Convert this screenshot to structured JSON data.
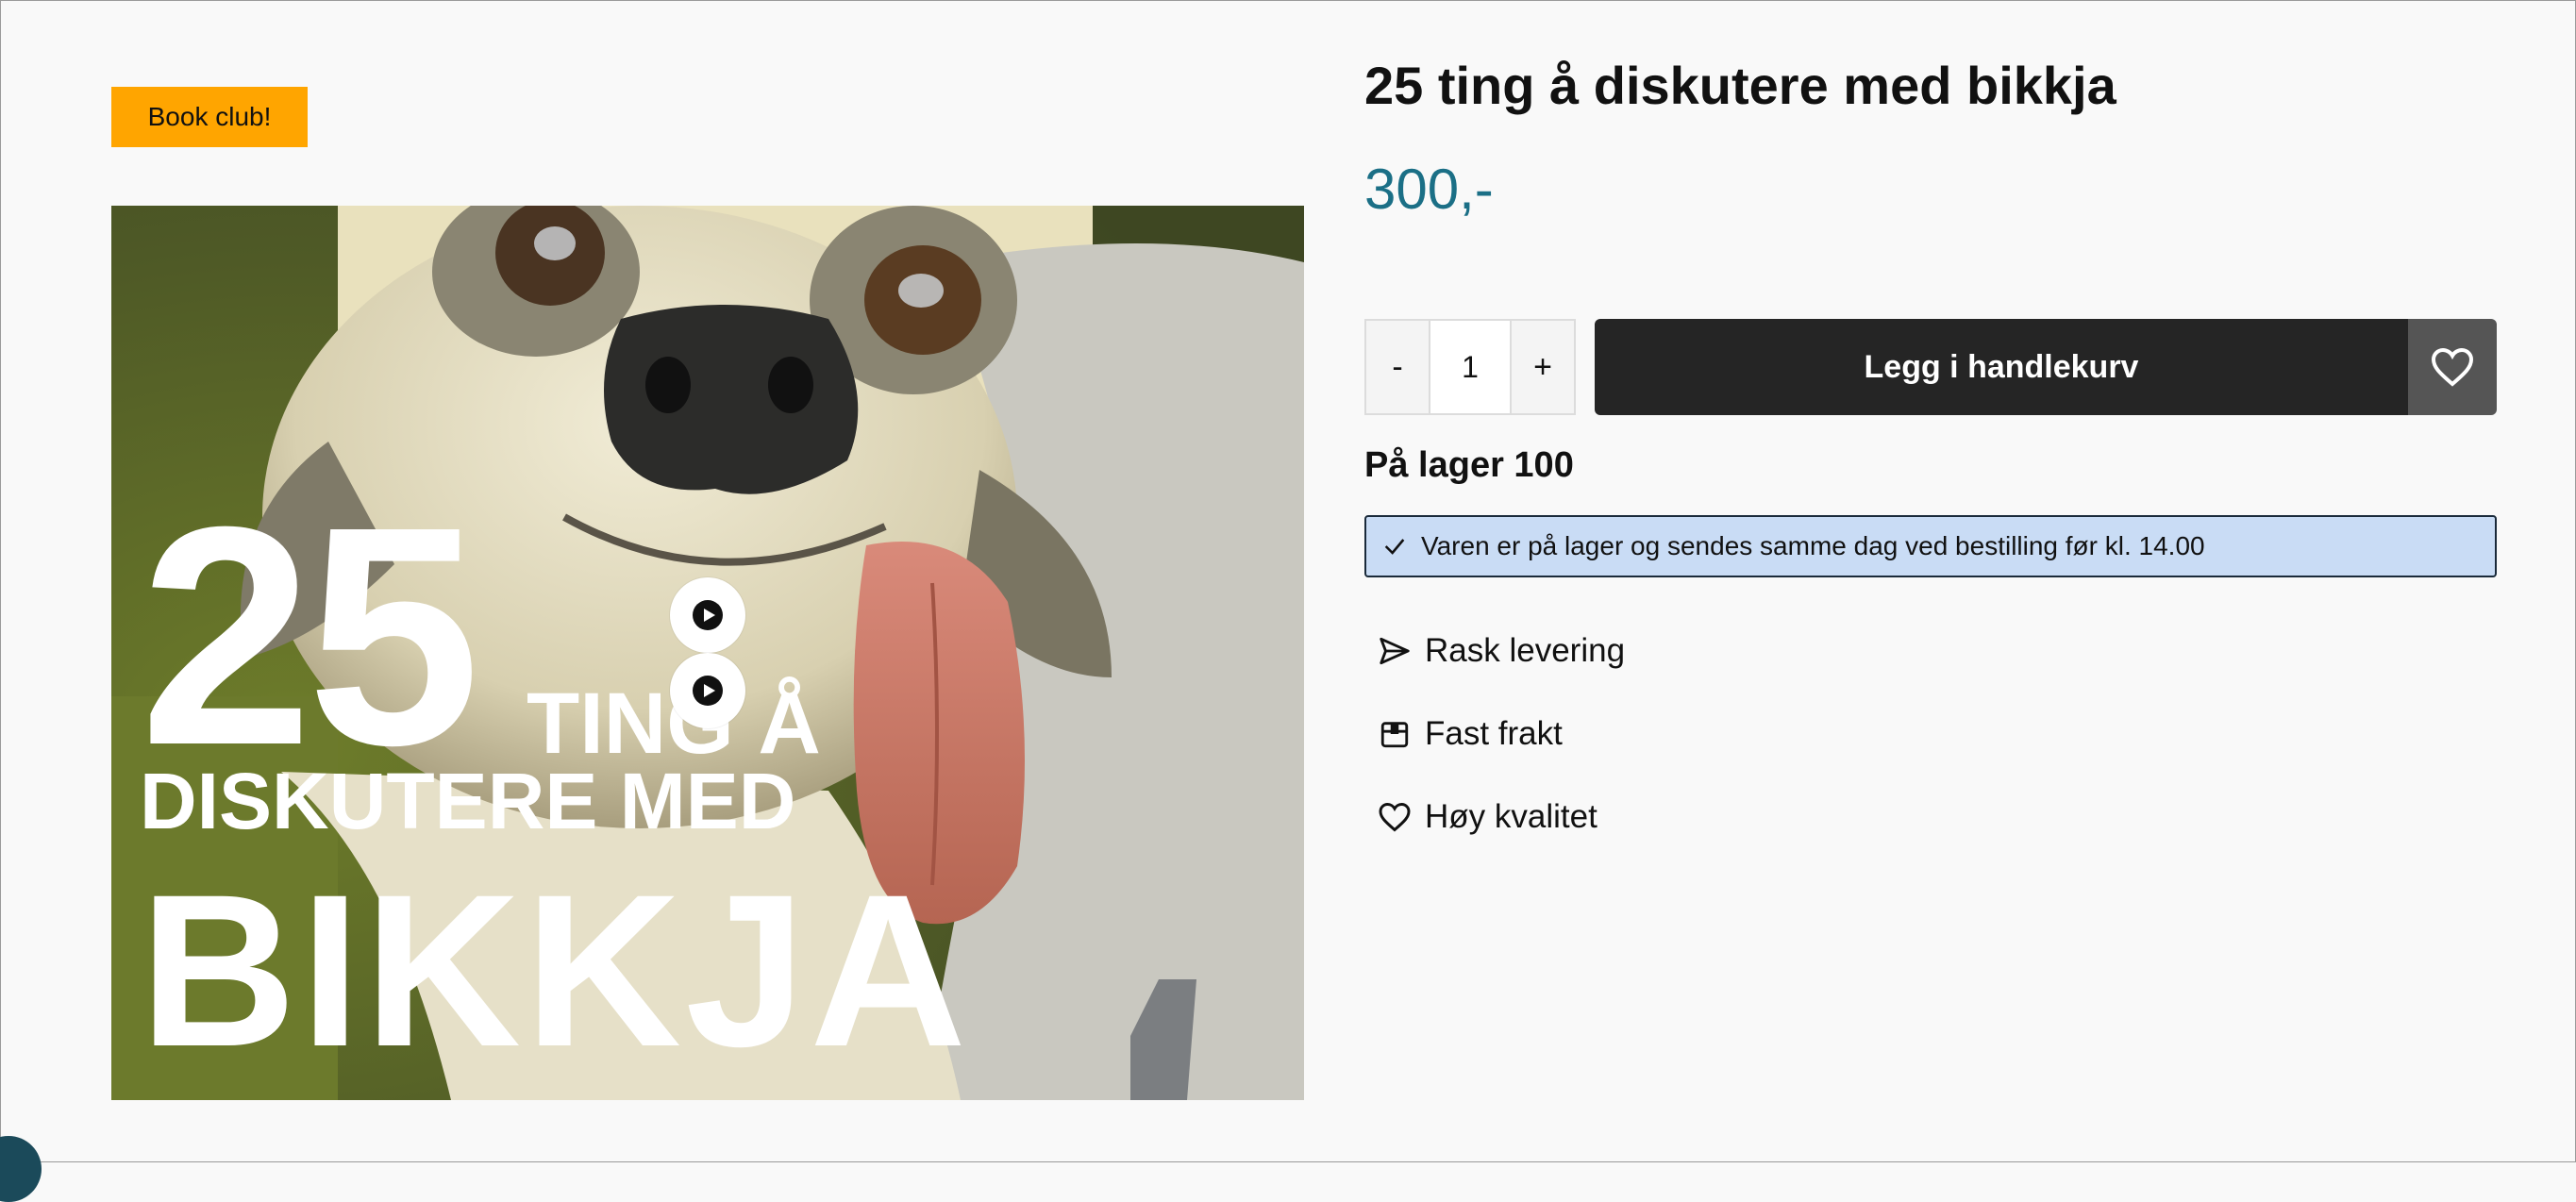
{
  "badge": {
    "label": "Book club!"
  },
  "product": {
    "title": "25 ting å diskutere med bikkja",
    "price": "300,-",
    "image_alt": "Dog with tongue out — book cover",
    "cover_text": {
      "number": "25",
      "line1": "TING Å",
      "line2": "DISKUTERE MED",
      "line3": "BIKKJA"
    }
  },
  "quantity": {
    "minus": "-",
    "value": "1",
    "plus": "+"
  },
  "cart": {
    "add_label": "Legg i handlekurv"
  },
  "stock": {
    "label": "På lager 100",
    "notice": "Varen er på lager og sendes samme dag ved bestilling før kl. 14.00"
  },
  "features": [
    {
      "icon": "send-icon",
      "label": "Rask levering"
    },
    {
      "icon": "box-icon",
      "label": "Fast frakt"
    },
    {
      "icon": "heart-icon",
      "label": "Høy kvalitet"
    }
  ],
  "colors": {
    "badge": "#ffa500",
    "price": "#1b6f86",
    "cart_button": "#252525",
    "wishlist_button": "#555555",
    "notice_bg": "#c9dcf5"
  }
}
